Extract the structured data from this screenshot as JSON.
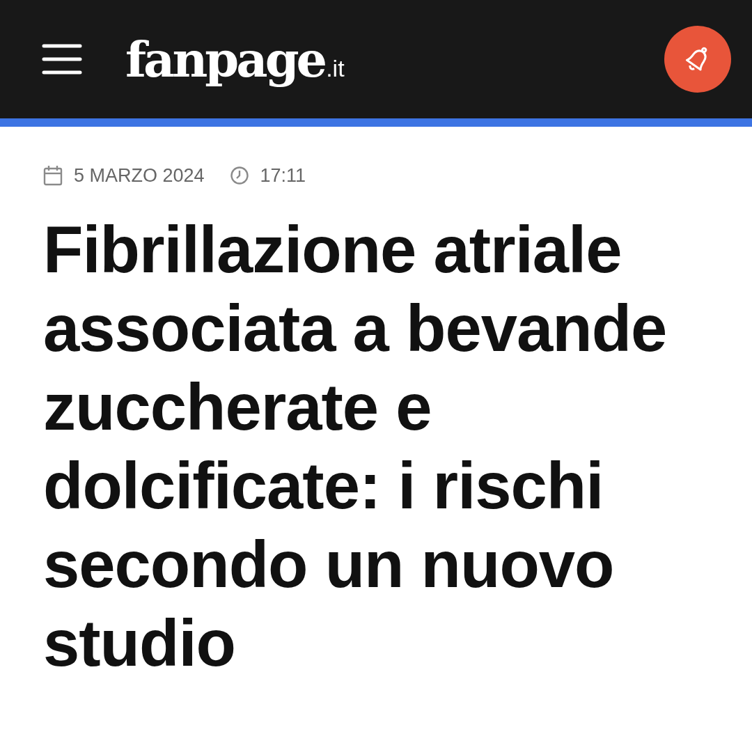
{
  "header": {
    "logo": {
      "name": "fanpage",
      "suffix": ".it"
    }
  },
  "article": {
    "date": "5 MARZO 2024",
    "time": "17:11",
    "title": "Fibrillazione atriale associata a bevande zuccherate e dolcificate: i rischi secondo un nuovo studio"
  }
}
